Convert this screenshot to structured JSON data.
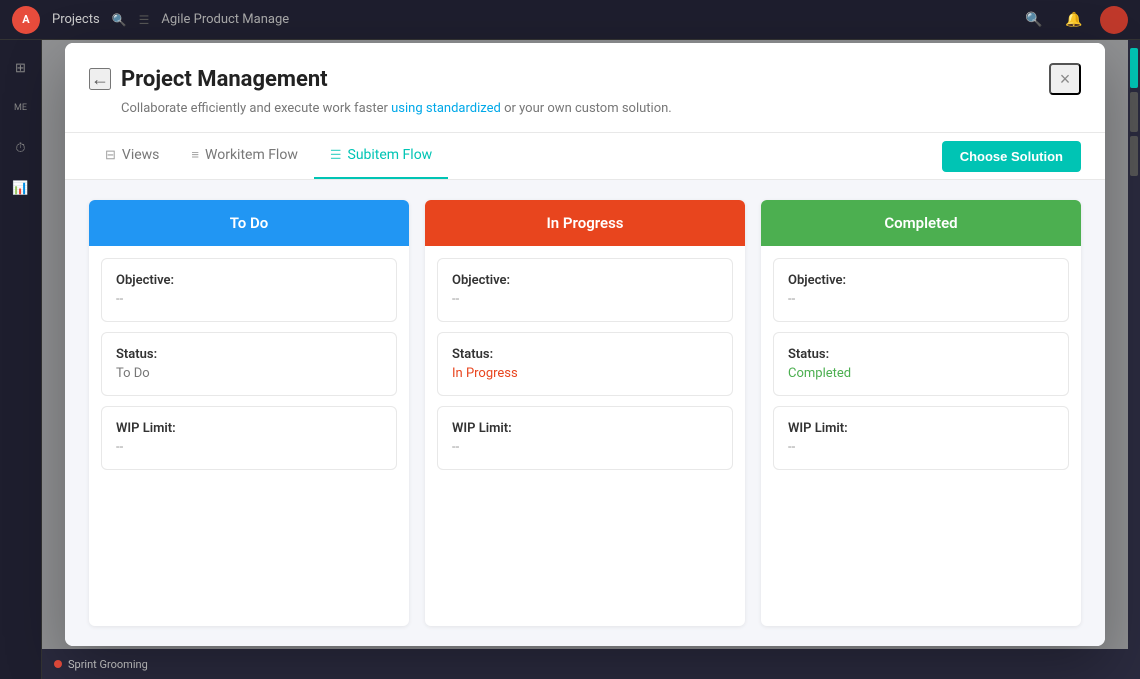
{
  "topbar": {
    "project_name": "Projects",
    "app_name": "Agile Product Manage",
    "avatar_initials": "A"
  },
  "sidebar": {
    "items": [
      {
        "label": "home",
        "icon": "⊞",
        "active": false
      },
      {
        "label": "ME",
        "text": "ME",
        "active": false
      },
      {
        "label": "timer",
        "icon": "⏱",
        "active": false
      },
      {
        "label": "chart",
        "icon": "📊",
        "active": true
      }
    ]
  },
  "modal": {
    "title": "Project Management",
    "subtitle": "Collaborate efficiently and execute work faster using standardized or your own custom solution.",
    "subtitle_link_text": "using standardized",
    "close_label": "×",
    "back_label": "←",
    "tabs": [
      {
        "id": "views",
        "label": "Views",
        "active": false
      },
      {
        "id": "workitem-flow",
        "label": "Workitem Flow",
        "active": false
      },
      {
        "id": "subitem-flow",
        "label": "Subitem Flow",
        "active": true
      }
    ],
    "choose_solution_label": "Choose Solution",
    "kanban": {
      "columns": [
        {
          "id": "todo",
          "header": "To Do",
          "header_class": "todo",
          "cards": [
            {
              "id": "objective",
              "label": "Objective:",
              "value": "--"
            },
            {
              "id": "status",
              "label": "Status:",
              "value": "To Do",
              "value_class": "todo-status"
            },
            {
              "id": "wip-limit",
              "label": "WIP Limit:",
              "value": "--"
            }
          ]
        },
        {
          "id": "inprogress",
          "header": "In Progress",
          "header_class": "inprogress",
          "cards": [
            {
              "id": "objective",
              "label": "Objective:",
              "value": "--"
            },
            {
              "id": "status",
              "label": "Status:",
              "value": "In Progress",
              "value_class": "inprogress-status"
            },
            {
              "id": "wip-limit",
              "label": "WIP Limit:",
              "value": "--"
            }
          ]
        },
        {
          "id": "completed",
          "header": "Completed",
          "header_class": "completed",
          "cards": [
            {
              "id": "objective",
              "label": "Objective:",
              "value": "--"
            },
            {
              "id": "status",
              "label": "Status:",
              "value": "Completed",
              "value_class": "completed-status"
            },
            {
              "id": "wip-limit",
              "label": "WIP Limit:",
              "value": "--"
            }
          ]
        }
      ]
    }
  },
  "bottombar": {
    "item_label": "Sprint Grooming"
  }
}
